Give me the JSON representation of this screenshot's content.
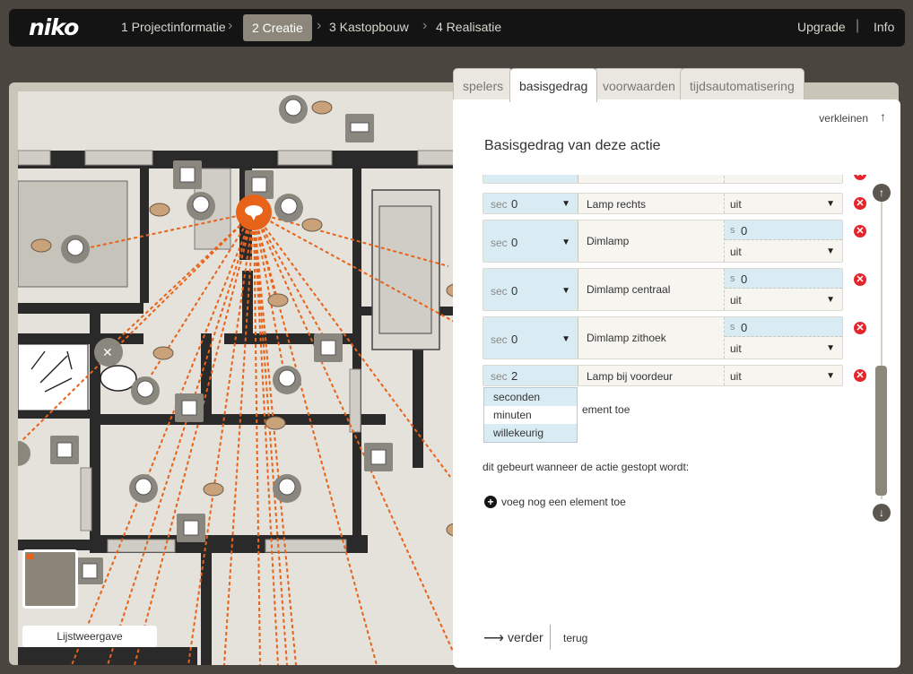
{
  "app": {
    "logo": "niko"
  },
  "steps": [
    {
      "label": "1 Projectinformatie",
      "active": false
    },
    {
      "label": "2 Creatie",
      "active": true
    },
    {
      "label": "3 Kastopbouw",
      "active": false
    },
    {
      "label": "4 Realisatie",
      "active": false
    }
  ],
  "topright": {
    "upgrade": "Upgrade",
    "info": "Info",
    "separator": "|"
  },
  "plan": {
    "list_view_label": "Lijstweergave"
  },
  "tabs": [
    {
      "label": "spelers",
      "active": false
    },
    {
      "label": "basisgedrag",
      "active": true
    },
    {
      "label": "voorwaarden",
      "active": false
    },
    {
      "label": "tijdsautomatisering",
      "active": false
    }
  ],
  "panel": {
    "shrink_label": "verkleinen",
    "title": "Basisgedrag van deze actie",
    "rows": [
      {
        "unit": "sec",
        "time": "0",
        "name": "Lamp rechts",
        "state": "uit",
        "type": "simple"
      },
      {
        "unit": "sec",
        "time": "0",
        "name": "Dimlamp",
        "dim_unit": "s",
        "dim_value": "0",
        "state": "uit",
        "type": "dim"
      },
      {
        "unit": "sec",
        "time": "0",
        "name": "Dimlamp centraal",
        "dim_unit": "s",
        "dim_value": "0",
        "state": "uit",
        "type": "dim"
      },
      {
        "unit": "sec",
        "time": "0",
        "name": "Dimlamp zithoek",
        "dim_unit": "s",
        "dim_value": "0",
        "state": "uit",
        "type": "dim"
      },
      {
        "unit": "sec",
        "time": "2",
        "name": "Lamp bij voordeur",
        "state": "uit",
        "type": "simple"
      }
    ],
    "dropdown_options": [
      "seconden",
      "minuten",
      "willekeurig"
    ],
    "add_element_partial": "ement toe",
    "stopped_text": "dit gebeurt wanneer de actie gestopt wordt:",
    "add_element_label": "voeg nog een element toe",
    "next_label": "verder",
    "back_label": "terug"
  },
  "colors": {
    "accent": "#e8631a",
    "delete": "#e4262c",
    "time_bg": "#d9ecf3",
    "topbar": "#141414"
  }
}
